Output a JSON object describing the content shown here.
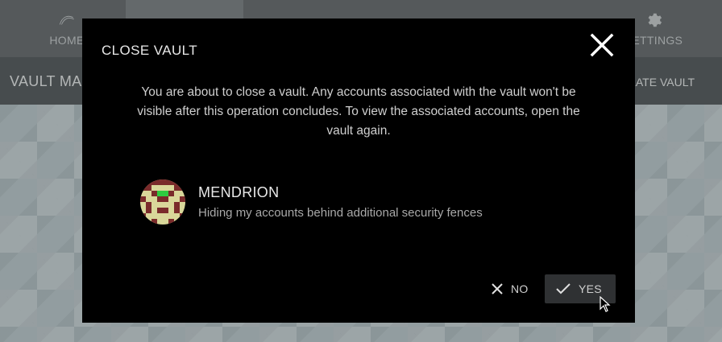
{
  "nav": {
    "items": [
      {
        "label": "HOME",
        "icon": "home-wave-icon"
      },
      {
        "label": "",
        "icon": "vault-icon"
      },
      {
        "label": "",
        "icon": "account-icon"
      },
      {
        "label": "",
        "icon": "grid-icon"
      },
      {
        "label": "",
        "icon": "fingerprint-icon"
      },
      {
        "label": "SETTINGS",
        "icon": "gear-icon"
      }
    ]
  },
  "subbar": {
    "title": "VAULT MA",
    "action": "EATE VAULT"
  },
  "dialog": {
    "title": "CLOSE VAULT",
    "message": "You are about to close a vault. Any accounts associated with the vault won't be visible after this operation concludes. To view the associated accounts, open the vault again.",
    "vault": {
      "name": "MENDRION",
      "description": "Hiding my accounts behind additional security fences"
    },
    "no_label": "NO",
    "yes_label": "YES"
  },
  "colors": {
    "dialog_bg": "#000000",
    "nav_bg": "#6d7375",
    "yes_button_bg": "#2f3133"
  }
}
